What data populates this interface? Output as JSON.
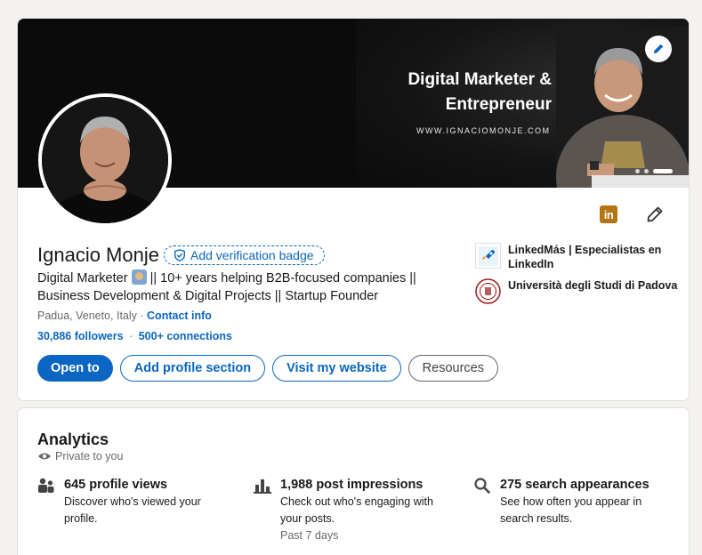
{
  "banner": {
    "title_line1": "Digital Marketer &",
    "title_line2": "Entrepreneur",
    "url": "WWW.IGNACIOMONJE.COM"
  },
  "profile": {
    "name": "Ignacio Monje",
    "verification_label": "Add verification badge",
    "headline_part1": "Digital Marketer",
    "headline_part2": "|| 10+ years helping B2B-focused companies || Business Development & Digital Projects || Startup Founder",
    "location": "Padua, Veneto, Italy",
    "contact_info": "Contact info",
    "followers": "30,886 followers",
    "connections": "500+ connections",
    "separator": "·"
  },
  "actions": {
    "open_to": "Open to",
    "add_section": "Add profile section",
    "visit_website": "Visit my website",
    "resources": "Resources"
  },
  "top_icons": {
    "linkedin_glyph": "in"
  },
  "organizations": [
    {
      "name": "LinkedMás | Especialistas en LinkedIn"
    },
    {
      "name": "Università degli Studi di Padova"
    }
  ],
  "analytics": {
    "title": "Analytics",
    "privacy": "Private to you",
    "metrics": [
      {
        "icon": "people-icon",
        "title": "645 profile views",
        "desc": "Discover who's viewed your profile.",
        "note": ""
      },
      {
        "icon": "bar-chart-icon",
        "title": "1,988 post impressions",
        "desc": "Check out who's engaging with your posts.",
        "note": "Past 7 days"
      },
      {
        "icon": "search-icon",
        "title": "275 search appearances",
        "desc": "See how often you appear in search results.",
        "note": ""
      }
    ]
  },
  "colors": {
    "brand": "#0a66c2",
    "background": "#f4f2ee",
    "linkedin_premium": "#b4740f"
  }
}
